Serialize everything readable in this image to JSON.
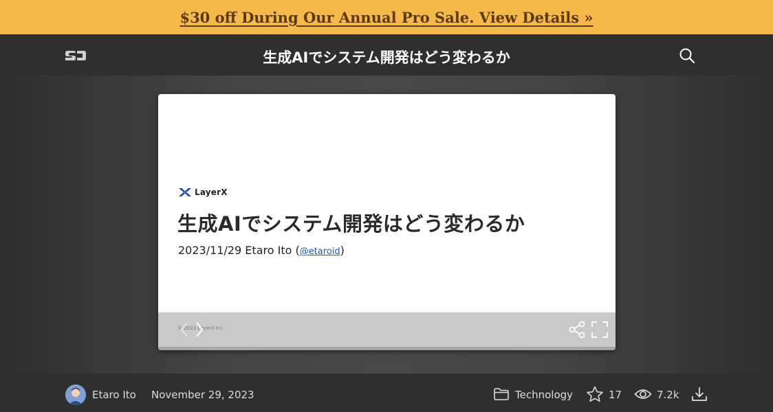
{
  "promo": {
    "text": "$30 off During Our Annual Pro Sale. View Details »"
  },
  "header": {
    "logo_icon": "speakerdeck-logo",
    "title": "生成AIでシステム開発はどう変わるか",
    "search_icon": "search-icon"
  },
  "slide": {
    "brand": "LayerX",
    "heading": "生成AIでシステム開発はどう変わるか",
    "meta_prefix": "2023/11/29  Etaro Ito (",
    "handle": "@etaroid",
    "meta_suffix": ")",
    "copyright": "© 2023 LayerX Inc."
  },
  "footer": {
    "author": "Etaro Ito",
    "date": "November 29, 2023",
    "category": "Technology",
    "stars": "17",
    "views": "7.2k"
  },
  "colors": {
    "promo_bg": "#f5b94a",
    "promo_text": "#5a3a08",
    "header_bg": "#2f2f2f",
    "link": "#1a56c8"
  }
}
